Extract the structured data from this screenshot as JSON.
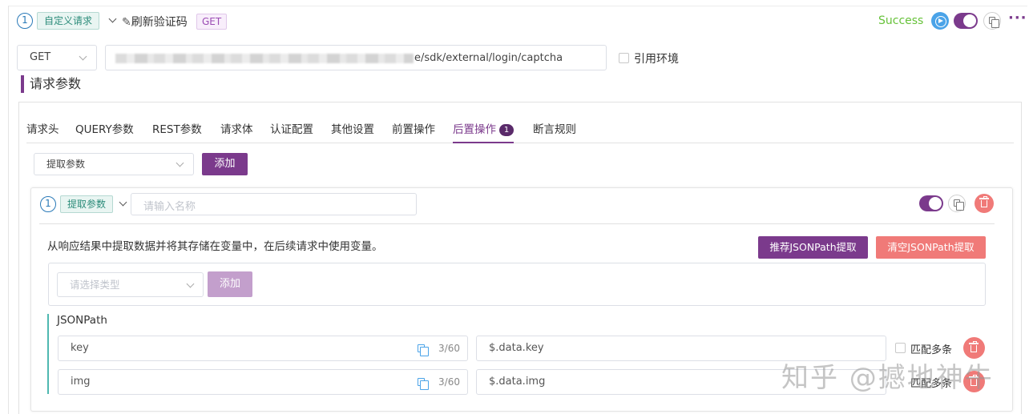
{
  "step": {
    "number": "1",
    "type_tag": "自定义请求",
    "name": "刷新验证码",
    "method_tag": "GET",
    "status": "Success"
  },
  "request": {
    "method": "GET",
    "url_visible": "e/sdk/external/login/captcha",
    "use_env_label": "引用环境"
  },
  "section_title": "请求参数",
  "tabs": [
    {
      "label": "请求头"
    },
    {
      "label": "QUERY参数"
    },
    {
      "label": "REST参数"
    },
    {
      "label": "请求体"
    },
    {
      "label": "认证配置"
    },
    {
      "label": "其他设置"
    },
    {
      "label": "前置操作"
    },
    {
      "label": "后置操作",
      "badge": "1",
      "active": true
    },
    {
      "label": "断言规则"
    }
  ],
  "post_ops": {
    "type_select": "提取参数",
    "add_label": "添加"
  },
  "extract_card": {
    "number": "1",
    "tag": "提取参数",
    "name_placeholder": "请输入名称",
    "description": "从响应结果中提取数据并将其存储在变量中，在后续请求中使用变量。",
    "recommend_label": "推荐JSONPath提取",
    "clear_label": "清空JSONPath提取",
    "type_placeholder": "请选择类型",
    "add_label": "添加",
    "jsonpath_label": "JSONPath",
    "match_multi_label": "匹配多条",
    "rows": [
      {
        "name": "key",
        "count": "3/60",
        "path": "$.data.key"
      },
      {
        "name": "img",
        "count": "3/60",
        "path": "$.data.img"
      }
    ]
  },
  "watermark": "知乎 @撼地神牛"
}
